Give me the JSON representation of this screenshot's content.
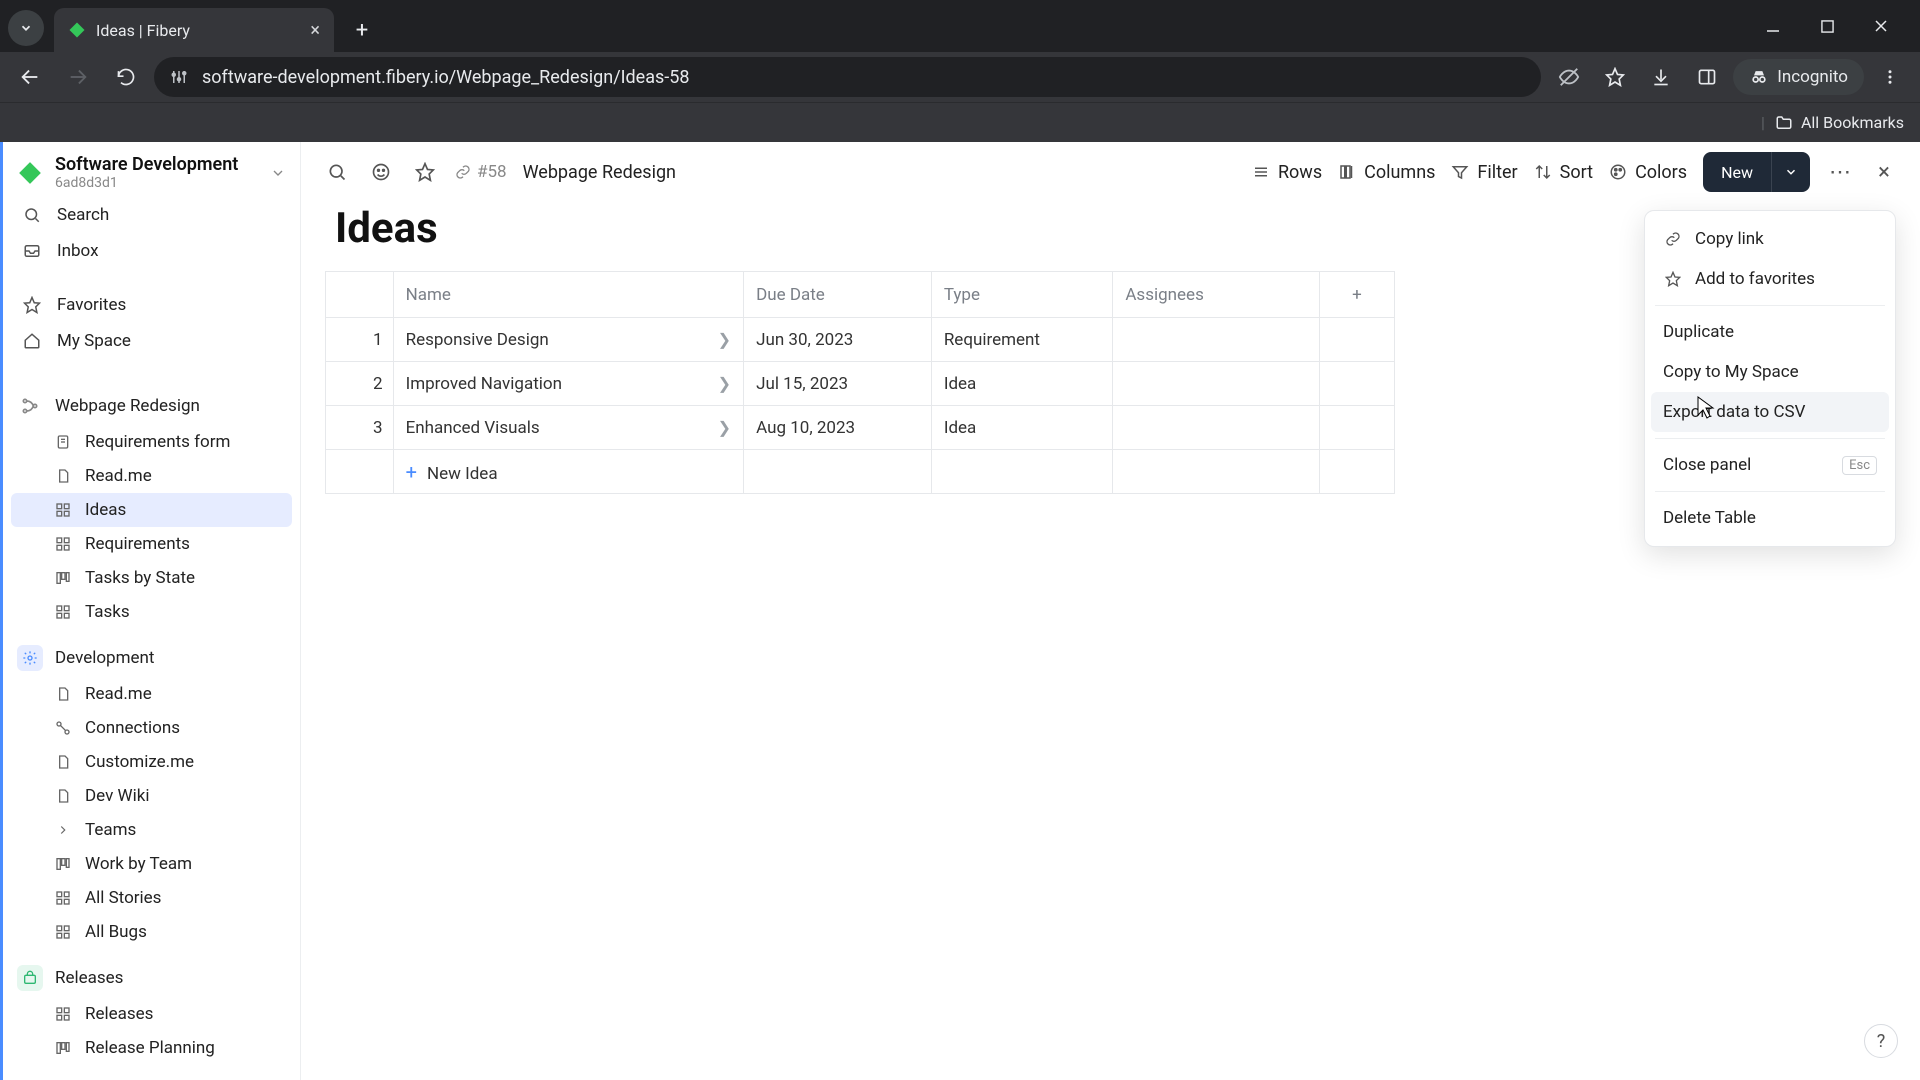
{
  "browser": {
    "tab_title": "Ideas | Fibery",
    "url": "software-development.fibery.io/Webpage_Redesign/Ideas-58",
    "incognito_label": "Incognito",
    "all_bookmarks_label": "All Bookmarks"
  },
  "workspace": {
    "name": "Software Development",
    "id": "6ad8d3d1"
  },
  "sidebar": {
    "search_label": "Search",
    "inbox_label": "Inbox",
    "favorites_label": "Favorites",
    "myspace_label": "My Space",
    "sections": [
      {
        "name": "Webpage Redesign",
        "icon_color": "#eef1f4",
        "items": [
          {
            "label": "Requirements form",
            "icon": "form"
          },
          {
            "label": "Read.me",
            "icon": "doc"
          },
          {
            "label": "Ideas",
            "icon": "grid",
            "active": true
          },
          {
            "label": "Requirements",
            "icon": "grid"
          },
          {
            "label": "Tasks by State",
            "icon": "board"
          },
          {
            "label": "Tasks",
            "icon": "grid"
          }
        ]
      },
      {
        "name": "Development",
        "icon_color": "#e6ecff",
        "items": [
          {
            "label": "Read.me",
            "icon": "doc"
          },
          {
            "label": "Connections",
            "icon": "connections"
          },
          {
            "label": "Customize.me",
            "icon": "doc"
          },
          {
            "label": "Dev Wiki",
            "icon": "doc"
          },
          {
            "label": "Teams",
            "icon": "caret"
          },
          {
            "label": "Work by Team",
            "icon": "board"
          },
          {
            "label": "All Stories",
            "icon": "grid"
          },
          {
            "label": "All Bugs",
            "icon": "grid"
          }
        ]
      },
      {
        "name": "Releases",
        "icon_color": "#e6f7ef",
        "items": [
          {
            "label": "Releases",
            "icon": "grid"
          },
          {
            "label": "Release Planning",
            "icon": "board"
          }
        ]
      }
    ]
  },
  "toolbar": {
    "record_ref": "#58",
    "breadcrumb": "Webpage Redesign",
    "rows_label": "Rows",
    "columns_label": "Columns",
    "filter_label": "Filter",
    "sort_label": "Sort",
    "colors_label": "Colors",
    "new_label": "New"
  },
  "page": {
    "title": "Ideas"
  },
  "table": {
    "columns": [
      "Name",
      "Due Date",
      "Type",
      "Assignees"
    ],
    "rows": [
      {
        "n": "1",
        "name": "Responsive Design",
        "due": "Jun 30, 2023",
        "type": "Requirement",
        "assignees": ""
      },
      {
        "n": "2",
        "name": "Improved Navigation",
        "due": "Jul 15, 2023",
        "type": "Idea",
        "assignees": ""
      },
      {
        "n": "3",
        "name": "Enhanced Visuals",
        "due": "Aug 10, 2023",
        "type": "Idea",
        "assignees": ""
      }
    ],
    "new_row_label": "New Idea"
  },
  "context_menu": {
    "copy_link": "Copy link",
    "add_fav": "Add to favorites",
    "duplicate": "Duplicate",
    "copy_space": "Copy to My Space",
    "export_csv": "Export data to CSV",
    "close_panel": "Close panel",
    "close_panel_kbd": "Esc",
    "delete_table": "Delete Table"
  },
  "help_label": "?"
}
